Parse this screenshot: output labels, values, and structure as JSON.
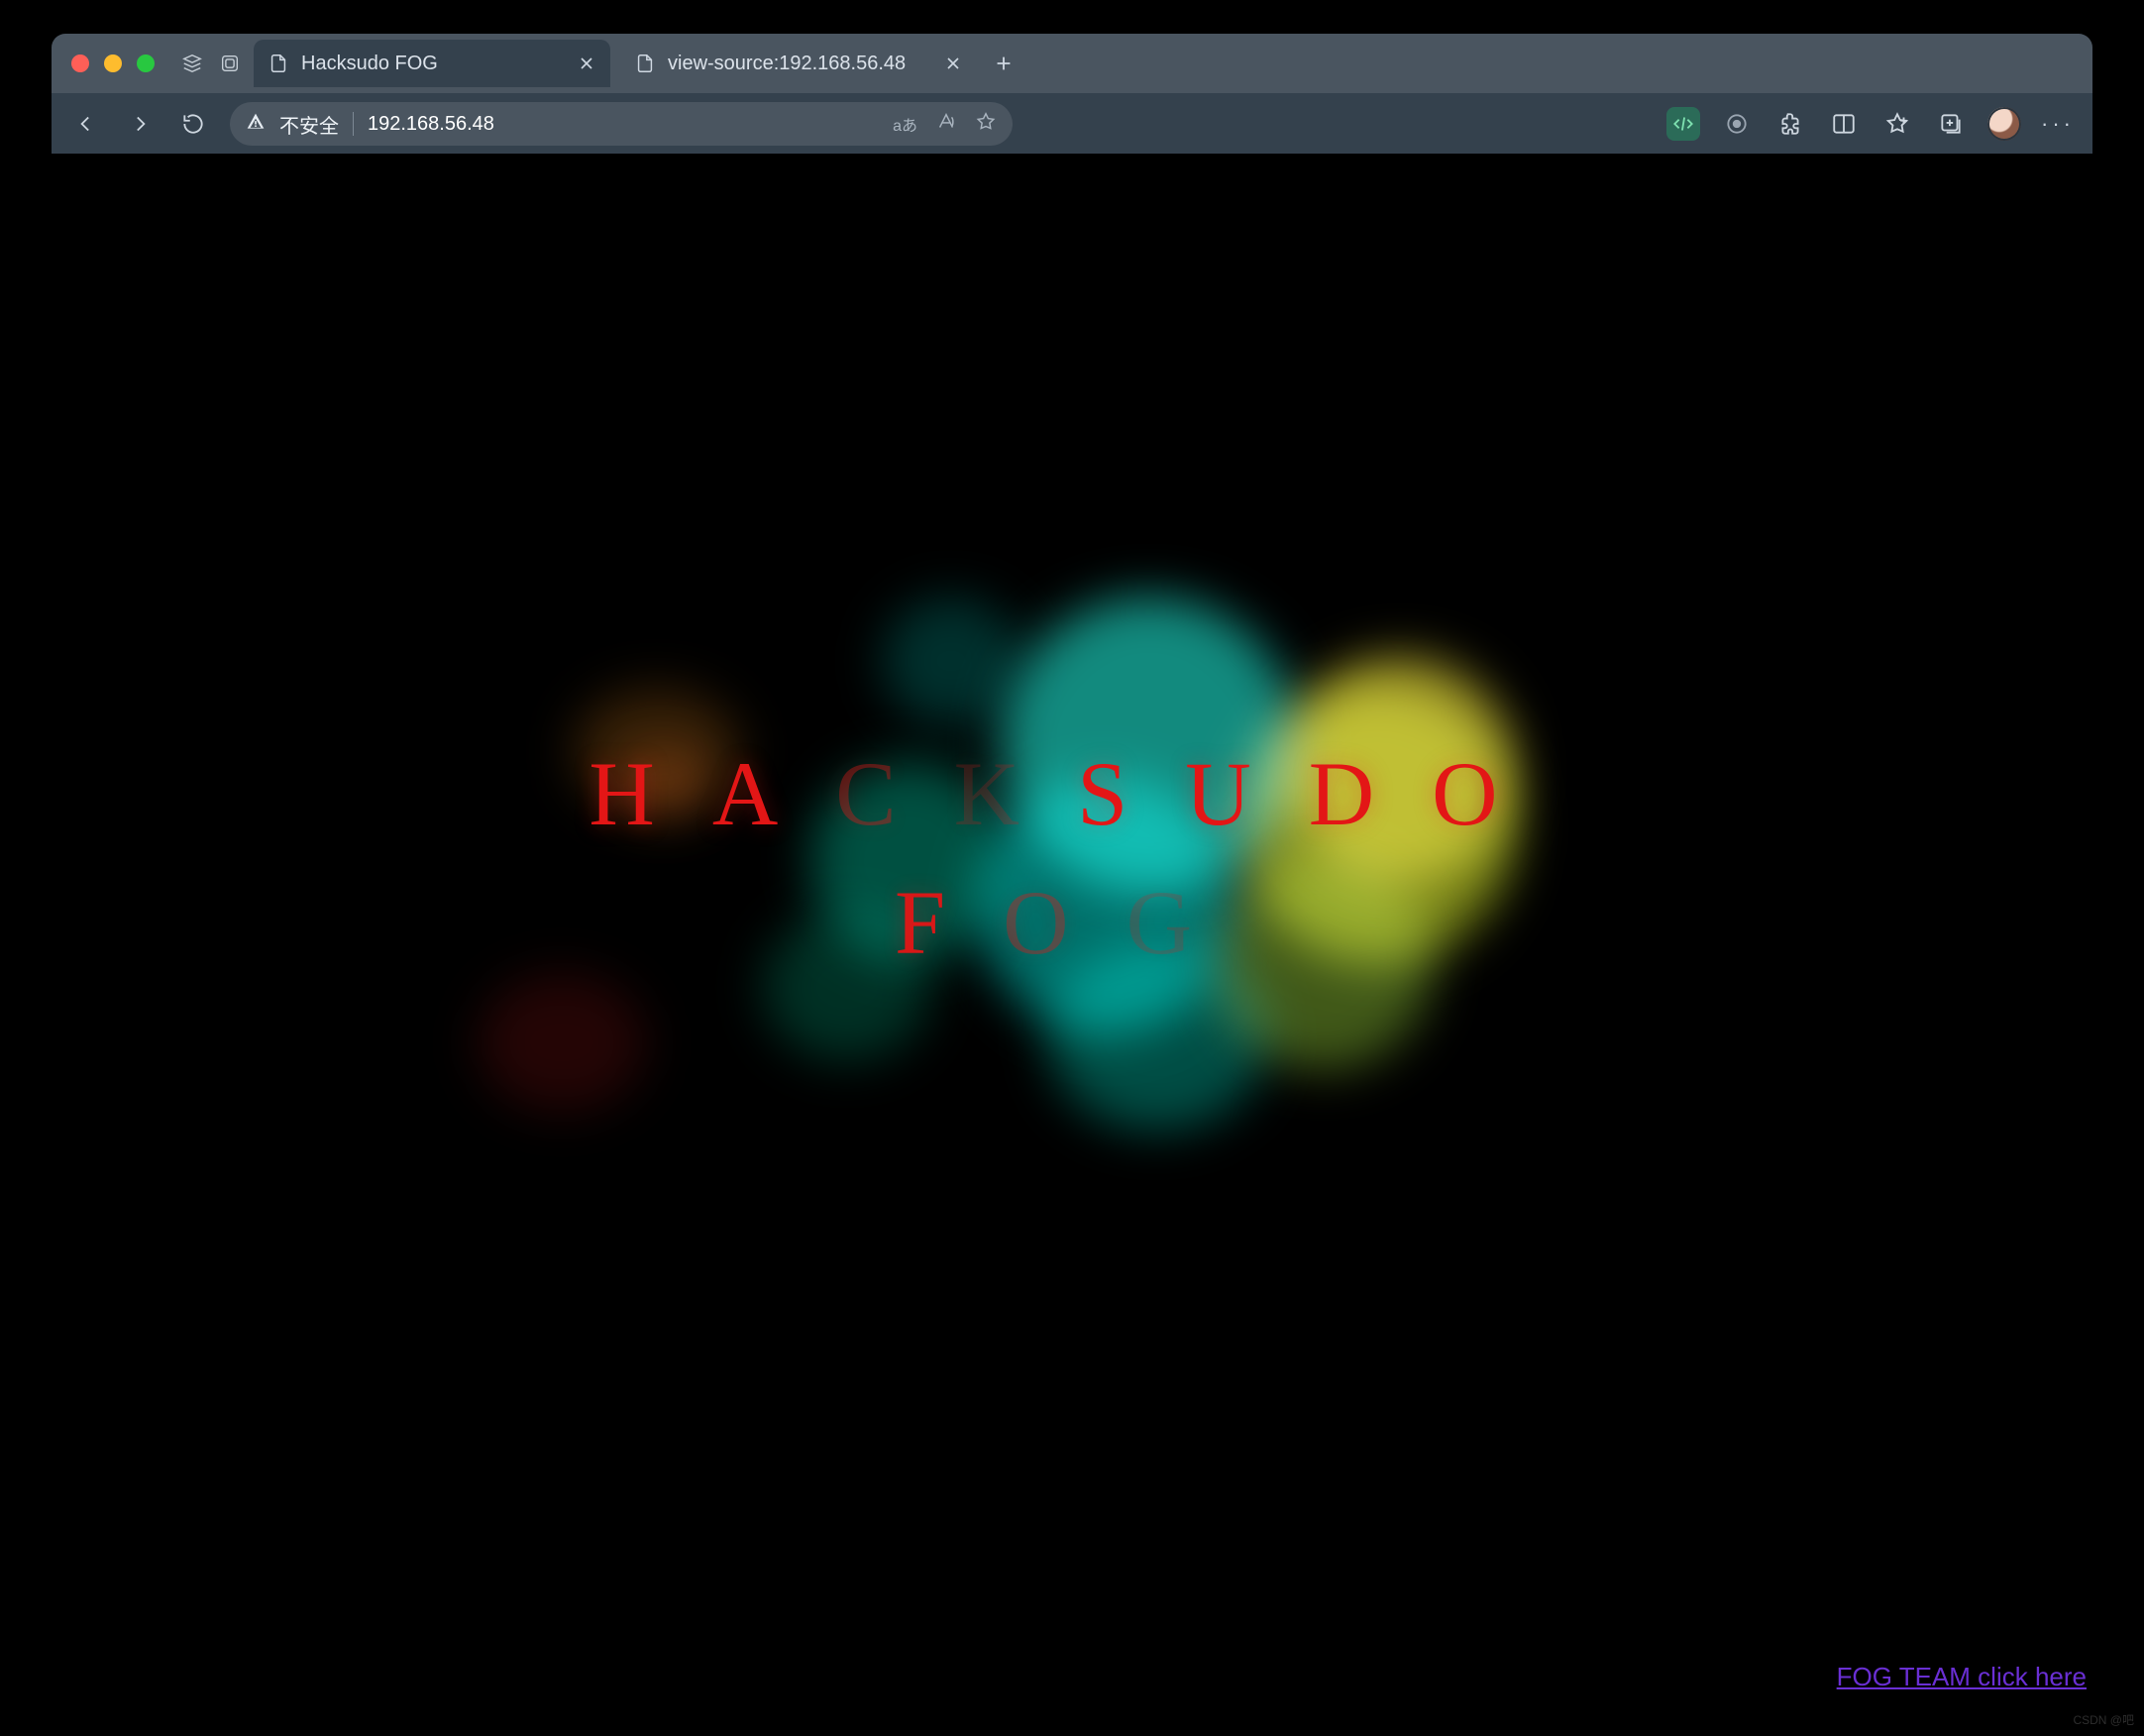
{
  "tabs": [
    {
      "label": "Hacksudo FOG",
      "active": true
    },
    {
      "label": "view-source:192.168.56.48",
      "active": false
    }
  ],
  "omnibox": {
    "security_label": "不安全",
    "url": "192.168.56.48",
    "lang_pill": "aあ"
  },
  "page": {
    "headline_row1": "HACKSUDO",
    "headline_row2": "FOG",
    "link_text": "FOG TEAM click here"
  },
  "watermark": "CSDN @吧"
}
